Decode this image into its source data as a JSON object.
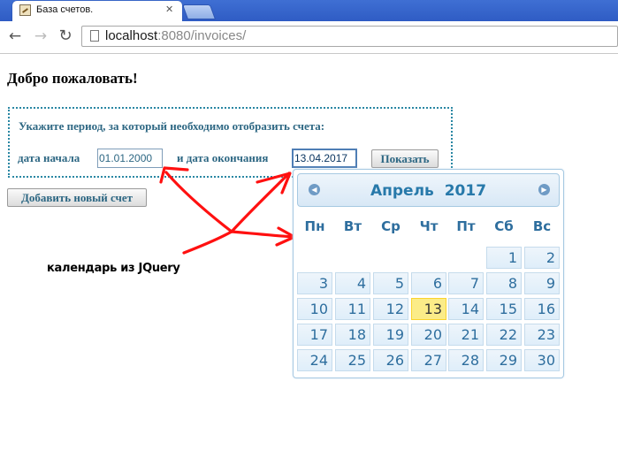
{
  "browser": {
    "tab_title": "База счетов.",
    "tab_close": "✕",
    "url_host": "localhost",
    "url_rest": ":8080/invoices/"
  },
  "page": {
    "title": "Добро пожаловать!",
    "filter": {
      "hint": "Укажите период, за который необходимо отобразить счета:",
      "start_label": "дата начала",
      "start_value": "01.01.2000",
      "end_label": "и дата окончания",
      "end_value": "13.04.2017",
      "show_button": "Показать"
    },
    "add_button": "Добавить новый счет"
  },
  "annotation": "календарь из JQuery",
  "calendar": {
    "month": "Апрель",
    "year": "2017",
    "weekdays": [
      "Пн",
      "Вт",
      "Ср",
      "Чт",
      "Пт",
      "Сб",
      "Вс"
    ],
    "weeks": [
      [
        "",
        "",
        "",
        "",
        "",
        "1",
        "2"
      ],
      [
        "3",
        "4",
        "5",
        "6",
        "7",
        "8",
        "9"
      ],
      [
        "10",
        "11",
        "12",
        "13",
        "14",
        "15",
        "16"
      ],
      [
        "17",
        "18",
        "19",
        "20",
        "21",
        "22",
        "23"
      ],
      [
        "24",
        "25",
        "26",
        "27",
        "28",
        "29",
        "30"
      ]
    ],
    "today": "13",
    "colors": {
      "header": "#2779aa",
      "today_bg": "#fbec88",
      "annotation_arrows": "#ff0000"
    }
  },
  "icons": {
    "back": "back-arrow-icon",
    "forward": "forward-arrow-icon",
    "reload": "reload-icon",
    "page": "page-icon",
    "prev_month": "prev-month-icon",
    "next_month": "next-month-icon"
  }
}
